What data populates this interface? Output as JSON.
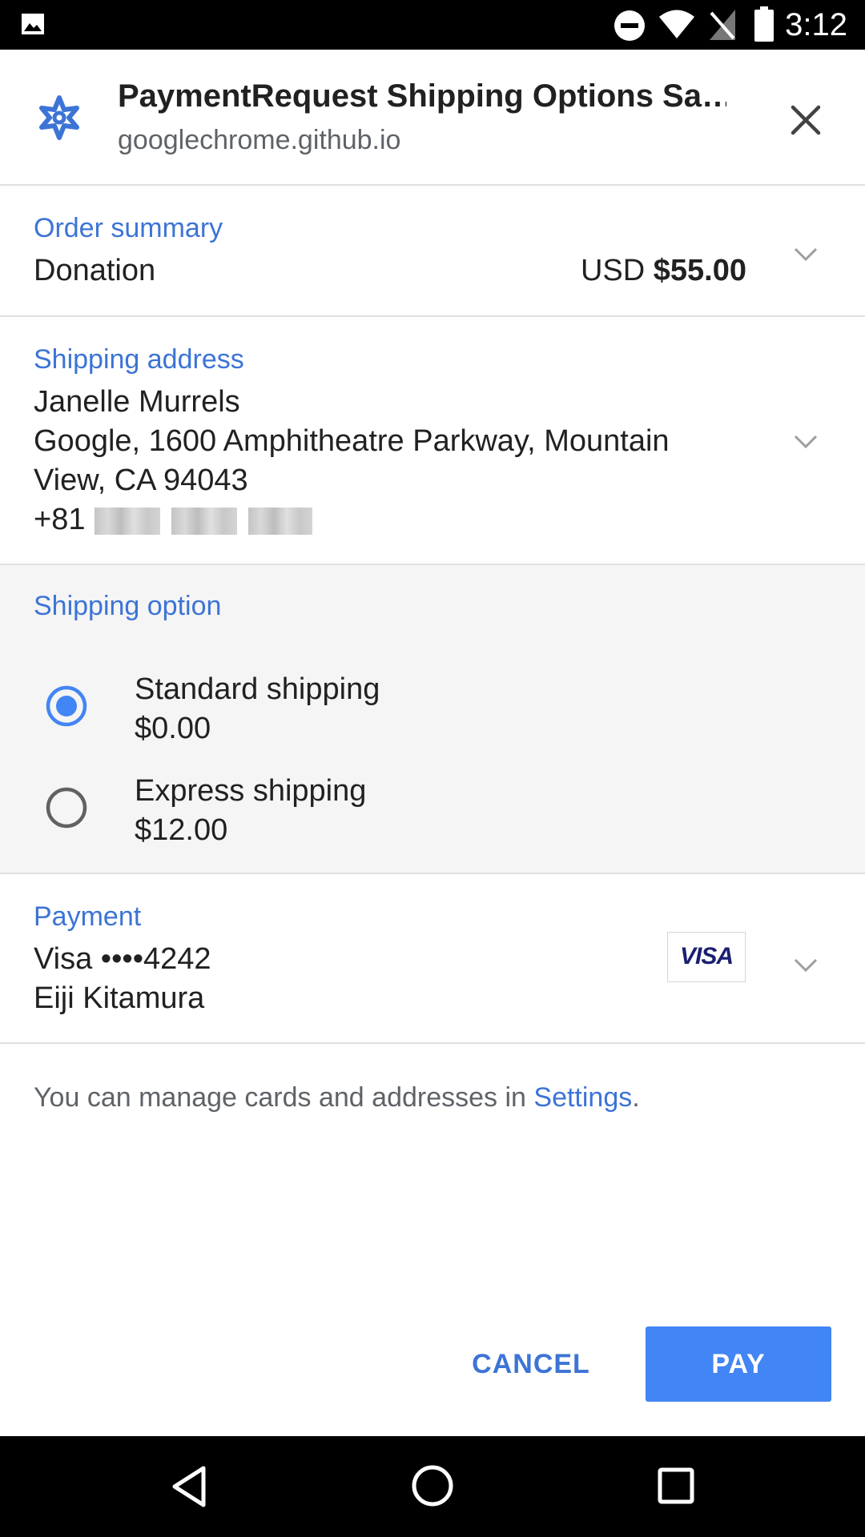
{
  "status_bar": {
    "time": "3:12"
  },
  "header": {
    "title": "PaymentRequest Shipping Options Sa…",
    "origin": "googlechrome.github.io"
  },
  "order_summary": {
    "label": "Order summary",
    "item": "Donation",
    "currency": "USD",
    "amount": "$55.00"
  },
  "shipping_address": {
    "label": "Shipping address",
    "name": "Janelle Murrels",
    "line1": "Google, 1600 Amphitheatre Parkway, Mountain",
    "line2": "View, CA 94043",
    "phone_prefix": "+81"
  },
  "shipping_option": {
    "label": "Shipping option",
    "options": [
      {
        "name": "Standard shipping",
        "price": "$0.00",
        "selected": true
      },
      {
        "name": "Express shipping",
        "price": "$12.00",
        "selected": false
      }
    ]
  },
  "payment": {
    "label": "Payment",
    "card": "Visa  ••••4242",
    "holder": "Eiji Kitamura",
    "brand_logo_text": "VISA"
  },
  "footnote": {
    "text": "You can manage cards and addresses in ",
    "link": "Settings",
    "end": "."
  },
  "actions": {
    "cancel": "CANCEL",
    "pay": "PAY"
  },
  "colors": {
    "accent": "#3c74d6",
    "pay_button": "#4285f4",
    "section_bg": "#f5f5f5"
  }
}
